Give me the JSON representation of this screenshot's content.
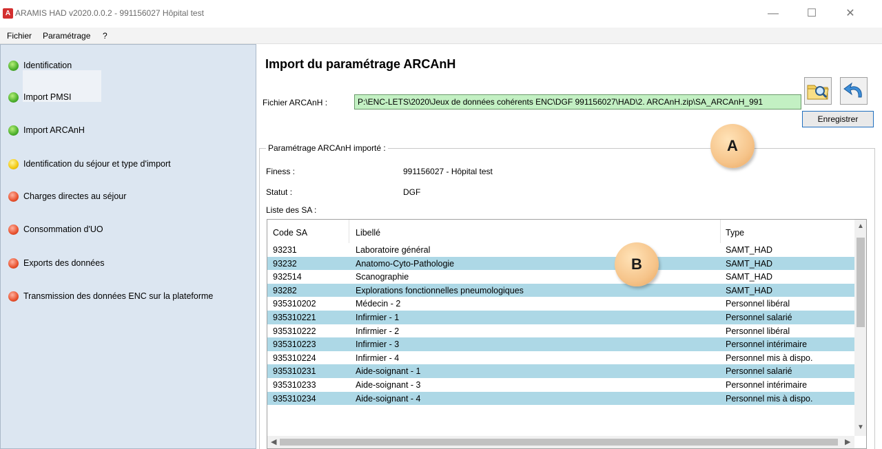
{
  "window": {
    "title": "ARAMIS HAD v2020.0.0.2  -  991156027  Hôpital test",
    "icon": "app-icon",
    "controls": {
      "minimize": "—",
      "maximize": "☐",
      "close": "✕"
    }
  },
  "menu": {
    "items": [
      "Fichier",
      "Paramétrage",
      "?"
    ]
  },
  "sidebar": {
    "items": [
      {
        "label": "Identification",
        "status": "green"
      },
      {
        "label": "Import PMSI",
        "status": "green"
      },
      {
        "label": "Import ARCAnH",
        "status": "green",
        "selected": true
      },
      {
        "label": "Identification du séjour et type d'import",
        "status": "yellow"
      },
      {
        "label": "Charges directes au séjour",
        "status": "red"
      },
      {
        "label": "Consommation d'UO",
        "status": "red"
      },
      {
        "label": "Exports des données",
        "status": "red"
      },
      {
        "label": "Transmission des données ENC sur la plateforme",
        "status": "red"
      }
    ],
    "colors": {
      "green": "#4caf2c",
      "yellow": "#f2c80f",
      "red": "#e8522e"
    }
  },
  "main": {
    "title": "Import du paramétrage ARCAnH",
    "file_label": "Fichier ARCAnH :",
    "file_value": "P:\\ENC-LETS\\2020\\Jeux de données cohérents ENC\\DGF 991156027\\HAD\\2. ARCAnH.zip\\SA_ARCAnH_991",
    "browse_icon": "folder-search-icon",
    "undo_icon": "undo-icon",
    "save_label": "Enregistrer",
    "group_label": "Paramétrage ARCAnH importé  :",
    "finess_label": "Finess :",
    "finess_value": "991156027 - Hôpital test",
    "statut_label": "Statut :",
    "statut_value": "DGF",
    "list_label": "Liste des SA :"
  },
  "table": {
    "columns": [
      "Code SA",
      "Libellé",
      "Type"
    ],
    "rows": [
      [
        "93231",
        "Laboratoire général",
        "SAMT_HAD"
      ],
      [
        "93232",
        "Anatomo-Cyto-Pathologie",
        "SAMT_HAD"
      ],
      [
        "932514",
        "Scanographie",
        "SAMT_HAD"
      ],
      [
        "93282",
        "Explorations fonctionnelles pneumologiques",
        "SAMT_HAD"
      ],
      [
        "935310202",
        "Médecin - 2",
        "Personnel libéral"
      ],
      [
        "935310221",
        "Infirmier - 1",
        "Personnel salarié"
      ],
      [
        "935310222",
        "Infirmier - 2",
        "Personnel libéral"
      ],
      [
        "935310223",
        "Infirmier - 3",
        "Personnel intérimaire"
      ],
      [
        "935310224",
        "Infirmier - 4",
        "Personnel mis à dispo."
      ],
      [
        "935310231",
        "Aide-soignant - 1",
        "Personnel salarié"
      ],
      [
        "935310233",
        "Aide-soignant - 3",
        "Personnel intérimaire"
      ],
      [
        "935310234",
        "Aide-soignant - 4",
        "Personnel mis à dispo."
      ]
    ],
    "alt_row_color": "#add8e6"
  },
  "callouts": {
    "a": "A",
    "b": "B"
  }
}
